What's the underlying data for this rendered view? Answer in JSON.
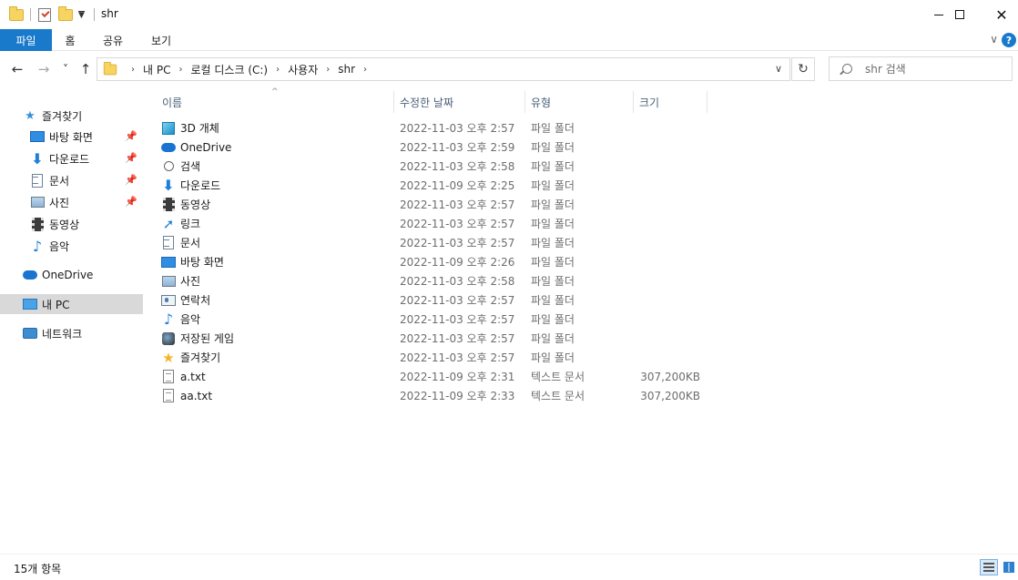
{
  "window": {
    "title": "shr",
    "minimize_icon": "minimize-icon",
    "maximize_icon": "maximize-icon",
    "close_glyph": "✕"
  },
  "ribbon": {
    "tabs": [
      "파일",
      "홈",
      "공유",
      "보기"
    ],
    "active_tab": "파일",
    "accent": "#1979ca",
    "expand_glyph": "∨",
    "help_glyph": "?"
  },
  "nav": {
    "back_glyph": "←",
    "forward_glyph": "→",
    "recent_glyph": "˅",
    "up_glyph": "↑",
    "breadcrumb": [
      "내 PC",
      "로컬 디스크 (C:)",
      "사용자",
      "shr"
    ],
    "dropdown_glyph": "∨",
    "refresh_glyph": "↻",
    "search_placeholder": "shr 검색"
  },
  "sidebar": {
    "quick_access": {
      "label": "즐겨찾기",
      "icon": "star-icon",
      "items": [
        {
          "label": "바탕 화면",
          "icon": "desktop-icon",
          "pinned": true
        },
        {
          "label": "다운로드",
          "icon": "download-icon",
          "pinned": true
        },
        {
          "label": "문서",
          "icon": "document-icon",
          "pinned": true
        },
        {
          "label": "사진",
          "icon": "picture-icon",
          "pinned": true
        },
        {
          "label": "동영상",
          "icon": "video-icon",
          "pinned": false
        },
        {
          "label": "음악",
          "icon": "music-icon",
          "pinned": false
        }
      ]
    },
    "onedrive": "OneDrive",
    "this_pc": "내 PC",
    "network": "네트워크",
    "pin_glyph": "📌"
  },
  "columns": {
    "name": "이름",
    "date": "수정한 날짜",
    "type": "유형",
    "size": "크기",
    "sort_glyph": "^"
  },
  "files": [
    {
      "name": "3D 개체",
      "date": "2022-11-03 오후 2:57",
      "type": "파일 폴더",
      "size": "",
      "icon": "3d-objects-icon"
    },
    {
      "name": "OneDrive",
      "date": "2022-11-03 오후 2:59",
      "type": "파일 폴더",
      "size": "",
      "icon": "onedrive-icon"
    },
    {
      "name": "검색",
      "date": "2022-11-03 오후 2:58",
      "type": "파일 폴더",
      "size": "",
      "icon": "search-icon"
    },
    {
      "name": "다운로드",
      "date": "2022-11-09 오후 2:25",
      "type": "파일 폴더",
      "size": "",
      "icon": "download-icon"
    },
    {
      "name": "동영상",
      "date": "2022-11-03 오후 2:57",
      "type": "파일 폴더",
      "size": "",
      "icon": "video-icon"
    },
    {
      "name": "링크",
      "date": "2022-11-03 오후 2:57",
      "type": "파일 폴더",
      "size": "",
      "icon": "link-icon"
    },
    {
      "name": "문서",
      "date": "2022-11-03 오후 2:57",
      "type": "파일 폴더",
      "size": "",
      "icon": "document-icon"
    },
    {
      "name": "바탕 화면",
      "date": "2022-11-09 오후 2:26",
      "type": "파일 폴더",
      "size": "",
      "icon": "desktop-icon"
    },
    {
      "name": "사진",
      "date": "2022-11-03 오후 2:58",
      "type": "파일 폴더",
      "size": "",
      "icon": "picture-icon"
    },
    {
      "name": "연락처",
      "date": "2022-11-03 오후 2:57",
      "type": "파일 폴더",
      "size": "",
      "icon": "contacts-icon"
    },
    {
      "name": "음악",
      "date": "2022-11-03 오후 2:57",
      "type": "파일 폴더",
      "size": "",
      "icon": "music-icon"
    },
    {
      "name": "저장된 게임",
      "date": "2022-11-03 오후 2:57",
      "type": "파일 폴더",
      "size": "",
      "icon": "saved-games-icon"
    },
    {
      "name": "즐겨찾기",
      "date": "2022-11-03 오후 2:57",
      "type": "파일 폴더",
      "size": "",
      "icon": "favorites-icon"
    },
    {
      "name": "a.txt",
      "date": "2022-11-09 오후 2:31",
      "type": "텍스트 문서",
      "size": "307,200KB",
      "icon": "text-file-icon"
    },
    {
      "name": "aa.txt",
      "date": "2022-11-09 오후 2:33",
      "type": "텍스트 문서",
      "size": "307,200KB",
      "icon": "text-file-icon"
    }
  ],
  "status": {
    "item_count": "15개 항목"
  }
}
